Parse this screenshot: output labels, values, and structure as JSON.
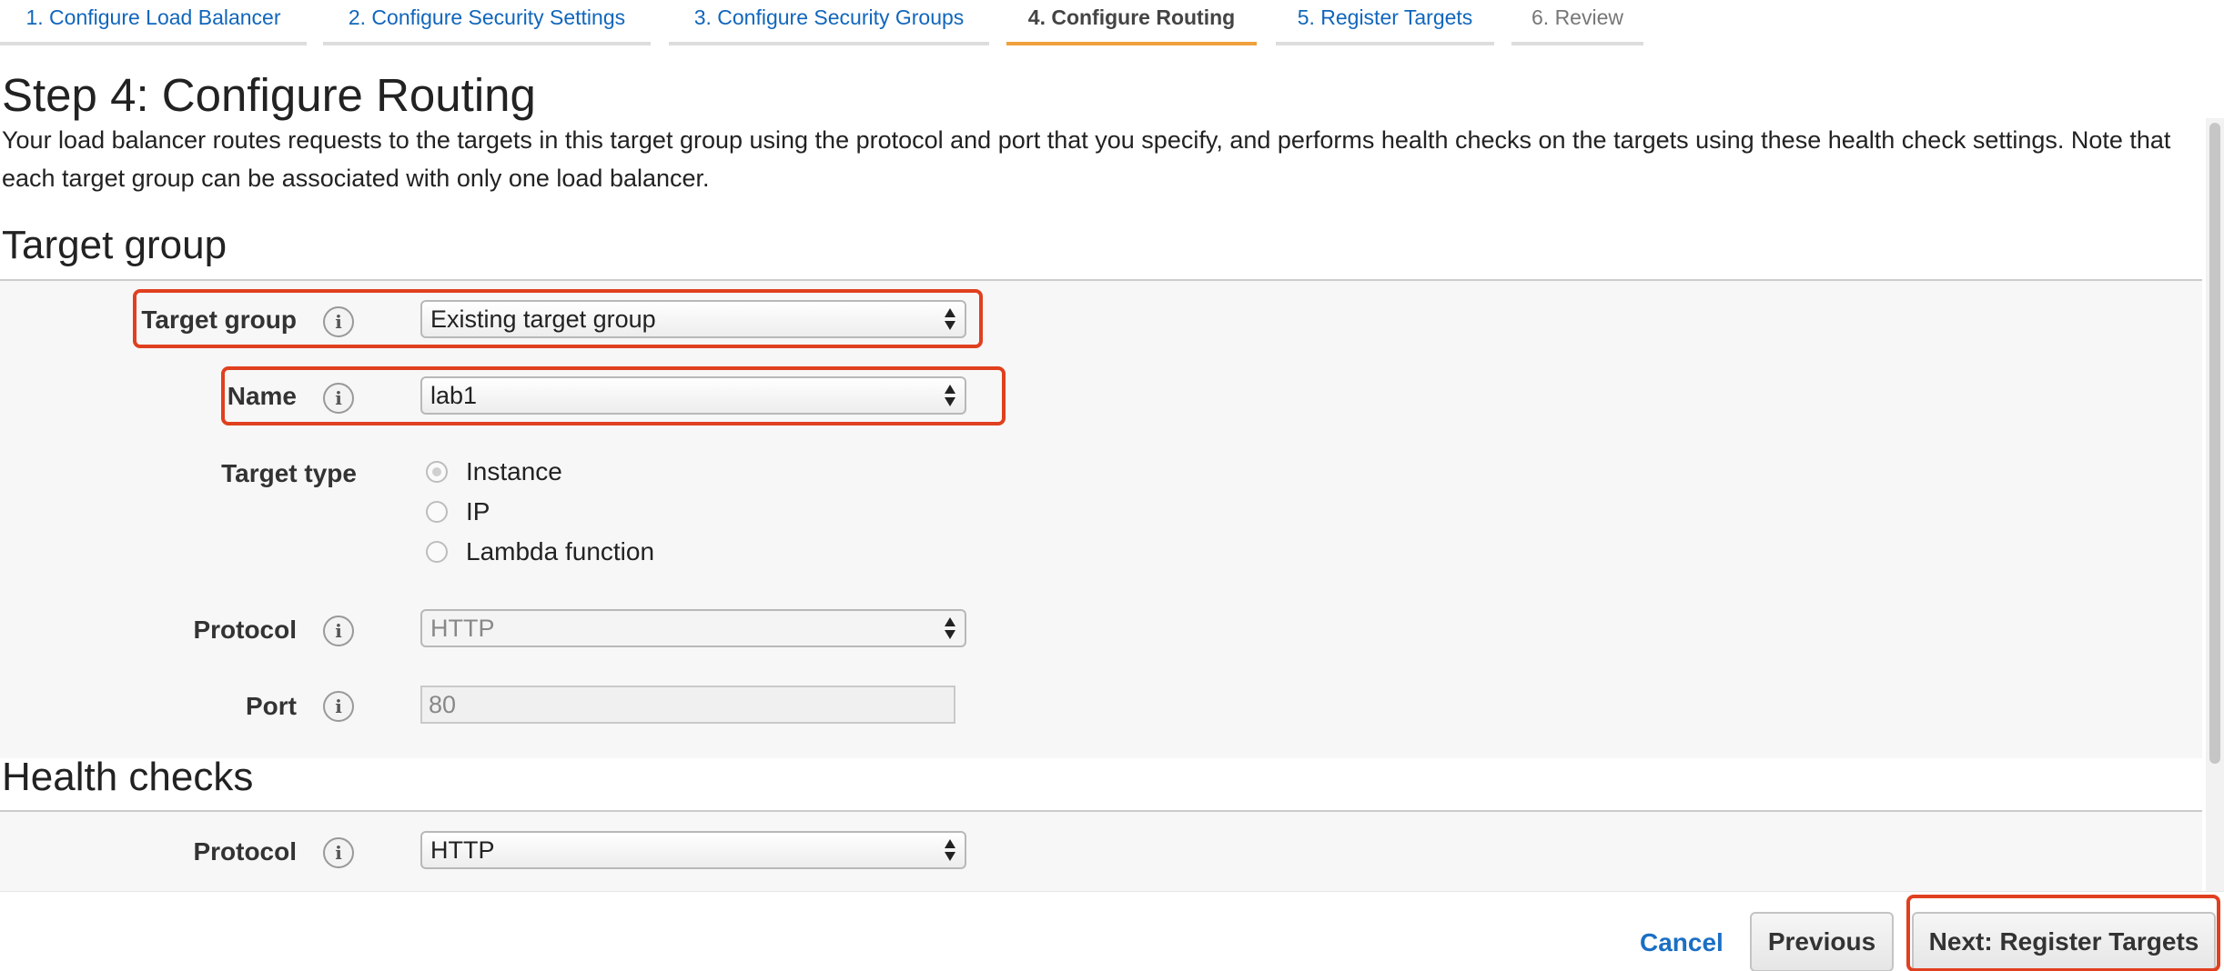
{
  "wizard": {
    "tabs": [
      {
        "label": "1. Configure Load Balancer",
        "state": "link"
      },
      {
        "label": "2. Configure Security Settings",
        "state": "link"
      },
      {
        "label": "3. Configure Security Groups",
        "state": "link"
      },
      {
        "label": "4. Configure Routing",
        "state": "active"
      },
      {
        "label": "5. Register Targets",
        "state": "link"
      },
      {
        "label": "6. Review",
        "state": "disabled"
      }
    ]
  },
  "page": {
    "title": "Step 4: Configure Routing",
    "intro": "Your load balancer routes requests to the targets in this target group using the protocol and port that you specify, and performs health checks on the targets using these health check settings. Note that each target group can be associated with only one load balancer."
  },
  "target_group_section": {
    "title": "Target group",
    "target_group": {
      "label": "Target group",
      "value": "Existing target group"
    },
    "name": {
      "label": "Name",
      "value": "lab1"
    },
    "target_type": {
      "label": "Target type",
      "options": [
        "Instance",
        "IP",
        "Lambda function"
      ],
      "selected": "Instance"
    },
    "protocol": {
      "label": "Protocol",
      "value": "HTTP"
    },
    "port": {
      "label": "Port",
      "value": "80"
    }
  },
  "health_checks_section": {
    "title": "Health checks",
    "protocol": {
      "label": "Protocol",
      "value": "HTTP"
    }
  },
  "footer": {
    "cancel_label": "Cancel",
    "previous_label": "Previous",
    "next_label": "Next: Register Targets"
  },
  "colors": {
    "link": "#1166bb",
    "active_tab_underline": "#f0a03c",
    "highlight": "#e0401f"
  },
  "icons": {
    "info": "info-icon",
    "select_arrows": "sort-arrows-icon"
  }
}
